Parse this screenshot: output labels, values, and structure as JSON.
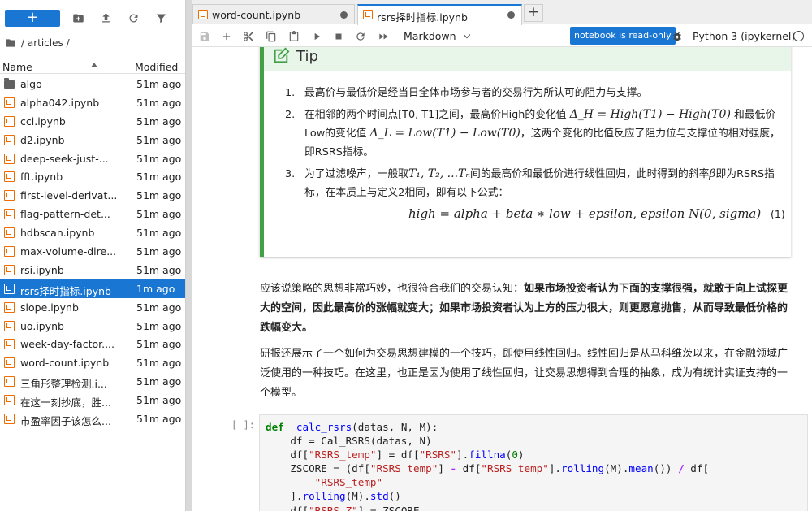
{
  "sidebar": {
    "new_label": "+",
    "breadcrumb": "/ articles /",
    "header": {
      "name": "Name",
      "modified": "Modified"
    },
    "files": [
      {
        "name": "algo",
        "type": "folder",
        "modified": "51m ago"
      },
      {
        "name": "alpha042.ipynb",
        "type": "notebook",
        "modified": "51m ago"
      },
      {
        "name": "cci.ipynb",
        "type": "notebook",
        "modified": "51m ago"
      },
      {
        "name": "d2.ipynb",
        "type": "notebook",
        "modified": "51m ago"
      },
      {
        "name": "deep-seek-just-...",
        "type": "notebook",
        "modified": "51m ago"
      },
      {
        "name": "fft.ipynb",
        "type": "notebook",
        "modified": "51m ago"
      },
      {
        "name": "first-level-derivat...",
        "type": "notebook",
        "modified": "51m ago"
      },
      {
        "name": "flag-pattern-det...",
        "type": "notebook",
        "modified": "51m ago"
      },
      {
        "name": "hdbscan.ipynb",
        "type": "notebook",
        "modified": "51m ago"
      },
      {
        "name": "max-volume-dire...",
        "type": "notebook",
        "modified": "51m ago"
      },
      {
        "name": "rsi.ipynb",
        "type": "notebook",
        "modified": "51m ago"
      },
      {
        "name": "rsrs择时指标.ipynb",
        "type": "notebook",
        "modified": "1m ago",
        "selected": true
      },
      {
        "name": "slope.ipynb",
        "type": "notebook",
        "modified": "51m ago"
      },
      {
        "name": "uo.ipynb",
        "type": "notebook",
        "modified": "51m ago"
      },
      {
        "name": "week-day-factor....",
        "type": "notebook",
        "modified": "51m ago"
      },
      {
        "name": "word-count.ipynb",
        "type": "notebook",
        "modified": "51m ago"
      },
      {
        "name": "三角形整理检测.i...",
        "type": "notebook",
        "modified": "51m ago"
      },
      {
        "name": "在这一刻抄底，胜...",
        "type": "notebook",
        "modified": "51m ago"
      },
      {
        "name": "市盈率因子该怎么...",
        "type": "notebook",
        "modified": "51m ago"
      }
    ]
  },
  "tabs": [
    {
      "label": "word-count.ipynb",
      "active": false
    },
    {
      "label": "rsrs择时指标.ipynb",
      "active": true
    }
  ],
  "toolbar": {
    "cell_type": "Markdown",
    "readonly_badge": "notebook is read-only",
    "kernel": "Python 3 (ipykernel)"
  },
  "tip": {
    "title": "Tip",
    "items": [
      {
        "num": "1.",
        "text": "最高价与最低价是经当日全体市场参与者的交易行为所认可的阻力与支撑。"
      },
      {
        "num": "2.",
        "t1": "在相邻的两个时间点[T0, T1]之间，最高价High的变化值 ",
        "m1": "Δ_H = High(T1) − High(T0)",
        "t2": " 和最低价Low的变化值 ",
        "m2": "Δ_L = Low(T1) − Low(T0)",
        "t3": "，这两个变化的比值反应了阻力位与支撑位的相对强度，即RSRS指标。"
      },
      {
        "num": "3.",
        "t1": "为了过滤噪声，一般取",
        "m1": "T₁, T₂, ...Tₙ",
        "t2": "间的最高价和最低价进行线性回归，此时得到的斜率",
        "m2": "β",
        "t3": "即为RSRS指标，在本质上与定义2相同，即有以下公式："
      }
    ],
    "formula": "high = alpha + beta ∗ low + epsilon, epsilon N(0, sigma)",
    "eq_number": "(1)"
  },
  "para1": {
    "plain": "应该说策略的思想非常巧妙，也很符合我们的交易认知：",
    "bold": "如果市场投资者认为下面的支撑很强，就敢于向上试探更大的空间，因此最高价的涨幅就变大；如果市场投资者认为上方的压力很大，则更愿意抛售，从而导致最低价格的跌幅变大。"
  },
  "para2": "研报还展示了一个如何为交易思想建模的一个技巧，即使用线性回归。线性回归是从马科维茨以来，在金融领域广泛使用的一种技巧。在这里，也正是因为使用了线性回归，让交易思想得到合理的抽象，成为有统计实证支持的一个模型。",
  "code": {
    "prompt": "[ ]:",
    "lines": [
      [
        [
          "kw",
          "def"
        ],
        [
          "",
          "  "
        ],
        [
          "fn",
          "calc_rsrs"
        ],
        [
          "",
          "(datas, N, M):"
        ]
      ],
      [
        [
          "",
          "    df = Cal_RSRS(datas, N)"
        ]
      ],
      [
        [
          "",
          "    df["
        ],
        [
          "st",
          "\"RSRS_temp\""
        ],
        [
          "",
          "] = df["
        ],
        [
          "st",
          "\"RSRS\""
        ],
        [
          "",
          "]."
        ],
        [
          "fn",
          "fillna"
        ],
        [
          "",
          "("
        ],
        [
          "nu",
          "0"
        ],
        [
          "",
          ")"
        ]
      ],
      [
        [
          "",
          "    ZSCORE = (df["
        ],
        [
          "st",
          "\"RSRS_temp\""
        ],
        [
          "",
          "] "
        ],
        [
          "op",
          "-"
        ],
        [
          "",
          ""
        ],
        [
          "",
          "df["
        ],
        [
          "st",
          "\"RSRS_temp\""
        ],
        [
          "",
          "]."
        ],
        [
          "fn",
          "rolling"
        ],
        [
          "",
          "(M)."
        ],
        [
          "fn",
          "mean"
        ],
        [
          "",
          "()) "
        ],
        [
          "op",
          "/"
        ],
        [
          "",
          ""
        ],
        [
          "",
          "df["
        ]
      ],
      [
        [
          "",
          "        "
        ],
        [
          "st",
          "\"RSRS_temp\""
        ]
      ],
      [
        [
          "",
          "    ]."
        ],
        [
          "fn",
          "rolling"
        ],
        [
          "",
          "(M)."
        ],
        [
          "fn",
          "std"
        ],
        [
          "",
          "()"
        ]
      ],
      [
        [
          "",
          "    df["
        ],
        [
          "st",
          "\"RSRS_Z\""
        ],
        [
          "",
          "] = ZSCORE"
        ]
      ]
    ]
  }
}
